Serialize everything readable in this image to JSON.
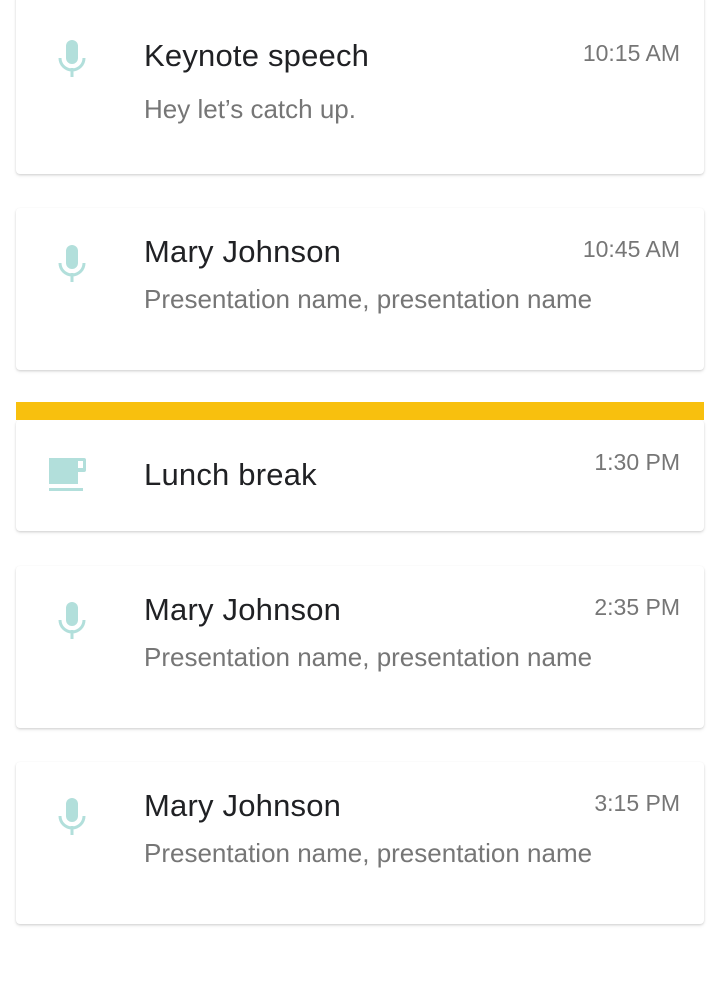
{
  "theme": {
    "accent_icon_color": "#B2DFDB",
    "highlight_bar_color": "#F8C00E"
  },
  "schedule": [
    {
      "icon": "microphone-icon",
      "title": "Keynote speech",
      "subtitle": "Hey let’s catch up.",
      "time": "10:15 AM"
    },
    {
      "icon": "microphone-icon",
      "title": "Mary Johnson",
      "subtitle": "Presentation name, presentation name",
      "time": "10:45 AM"
    },
    {
      "icon": "coffee-cup-icon",
      "title": "Lunch break",
      "subtitle": "",
      "time": "1:30 PM",
      "highlighted": true
    },
    {
      "icon": "microphone-icon",
      "title": "Mary Johnson",
      "subtitle": "Presentation name, presentation name",
      "time": "2:35 PM"
    },
    {
      "icon": "microphone-icon",
      "title": "Mary Johnson",
      "subtitle": "Presentation name, presentation name",
      "time": "3:15 PM"
    }
  ]
}
